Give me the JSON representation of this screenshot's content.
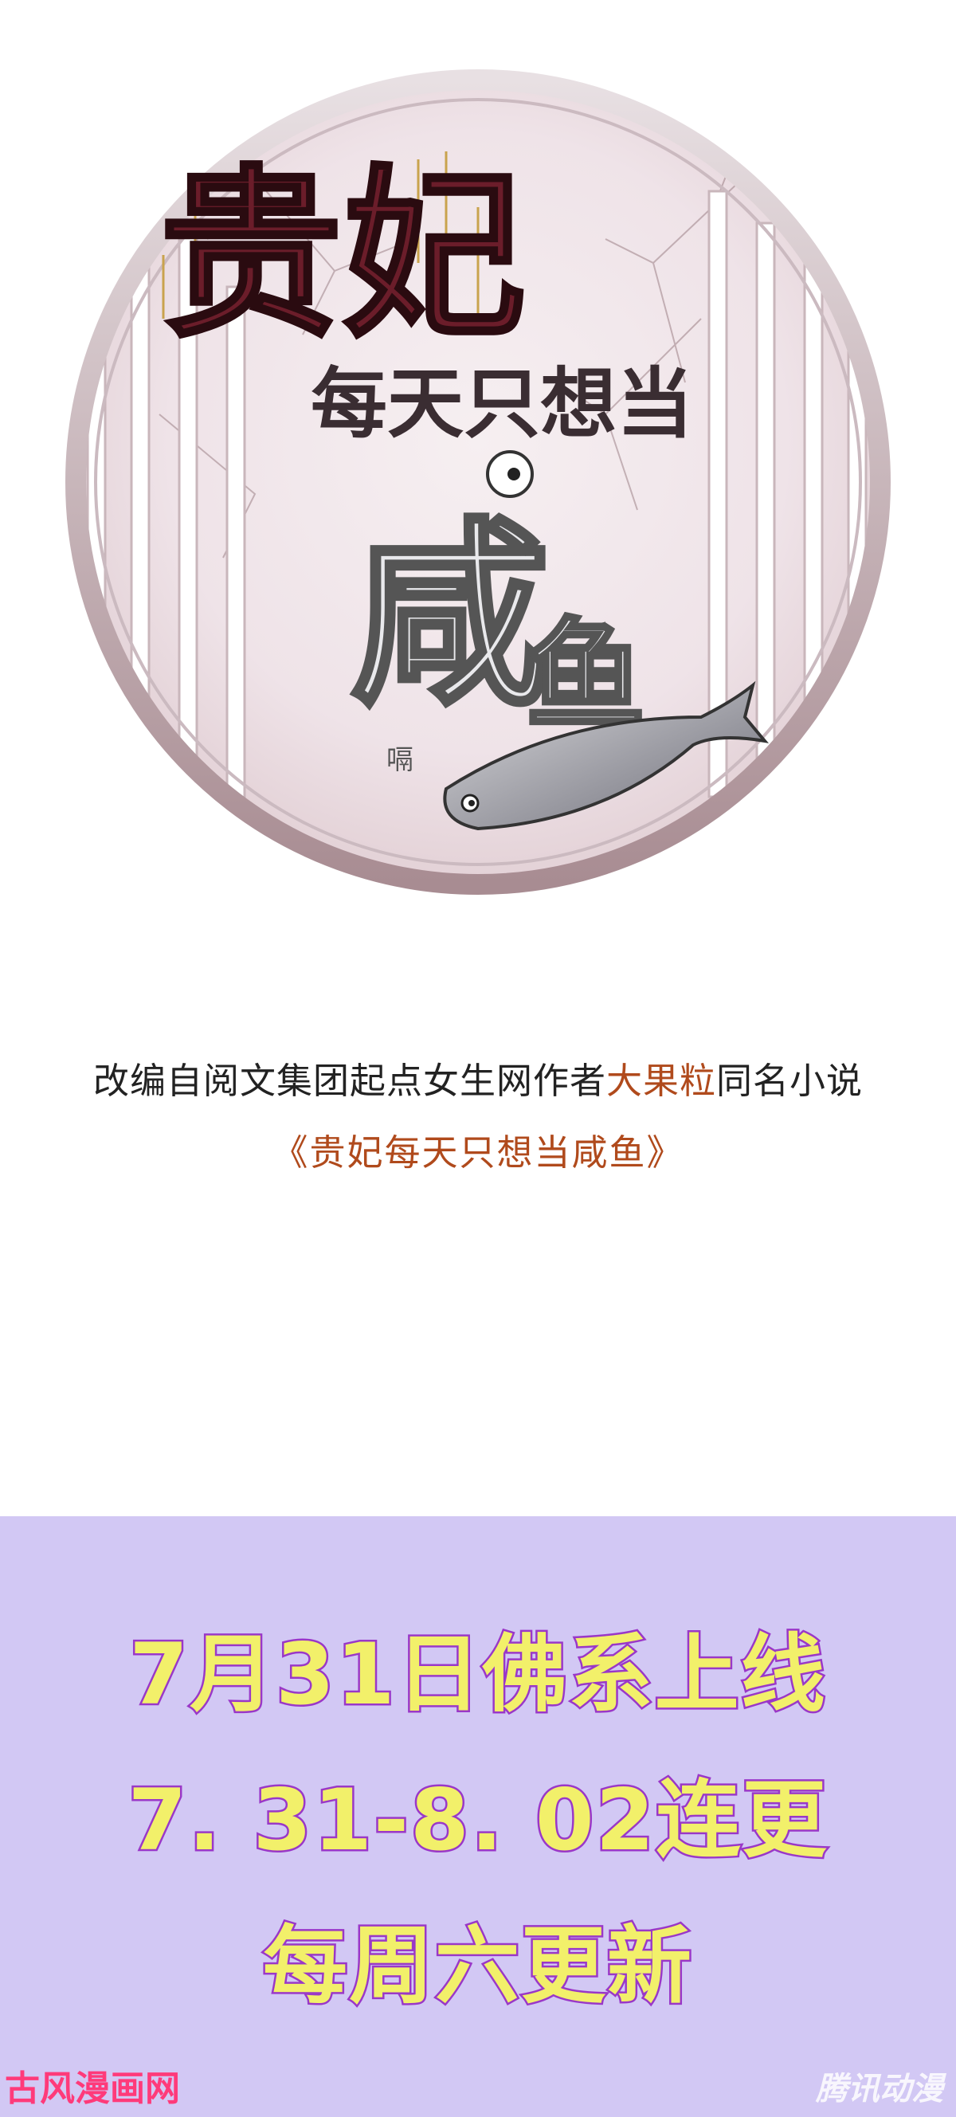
{
  "logo": {
    "title_line1": "贵妃",
    "title_line2": "每天只想当",
    "title_char": "咸",
    "title_char2": "鱼"
  },
  "credit": {
    "prefix": "改编自阅文集团起点女生网作者",
    "author": "大果粒",
    "suffix": "同名小说"
  },
  "novel_title": "《贵妃每天只想当咸鱼》",
  "promo": {
    "line1": "7月31日佛系上线",
    "line2": "7. 31-8. 02连更",
    "line3": "每周六更新"
  },
  "watermarks": {
    "left": "古风漫画网",
    "right": "腾讯动漫"
  },
  "colors": {
    "promo_bg": "#d2c8f4",
    "promo_text": "#f2f06a",
    "promo_stroke": "#9a38c8",
    "accent_text": "#b04a1c"
  }
}
